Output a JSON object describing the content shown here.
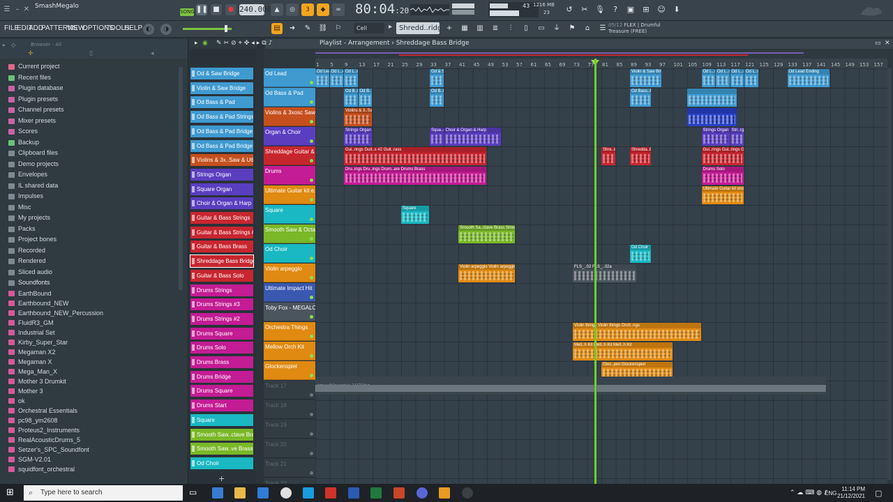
{
  "app": {
    "project_name": "SmashMegalo",
    "song_mode": "SONG",
    "tempo": "240.000",
    "time": {
      "main": "80:04",
      "sub": "20"
    },
    "cpu_value": "43",
    "memory": "1216 MB",
    "voices": "23"
  },
  "menu": {
    "items": [
      "FILE",
      "EDIT",
      "ADD",
      "PATTERNS",
      "VIEW",
      "OPTIONS",
      "TOOLS",
      "HELP"
    ],
    "snap": "Cell",
    "pattern": "Shredd..ridge",
    "plugin_info": {
      "index": "05/12",
      "name": "FLEX | Drumful",
      "preset": "Treasure (FREE)"
    }
  },
  "browser": {
    "header": "Browser - All",
    "folders": [
      {
        "label": "Current project",
        "color": "#e06a8a"
      },
      {
        "label": "Recent files",
        "color": "#6ac27a"
      },
      {
        "label": "Plugin database",
        "color": "#c864a6"
      },
      {
        "label": "Plugin presets",
        "color": "#c864a6"
      },
      {
        "label": "Channel presets",
        "color": "#c864a6"
      },
      {
        "label": "Mixer presets",
        "color": "#c864a6"
      },
      {
        "label": "Scores",
        "color": "#c864a6"
      },
      {
        "label": "Backup",
        "color": "#6ac27a"
      },
      {
        "label": "Clipboard files",
        "color": "#7d8a93"
      },
      {
        "label": "Demo projects",
        "color": "#7d8a93"
      },
      {
        "label": "Envelopes",
        "color": "#7d8a93"
      },
      {
        "label": "IL shared data",
        "color": "#7d8a93"
      },
      {
        "label": "Impulses",
        "color": "#7d8a93"
      },
      {
        "label": "Misc",
        "color": "#7d8a93"
      },
      {
        "label": "My projects",
        "color": "#7d8a93"
      },
      {
        "label": "Packs",
        "color": "#7d8a93"
      },
      {
        "label": "Project bones",
        "color": "#7d8a93"
      },
      {
        "label": "Recorded",
        "color": "#7d8a93"
      },
      {
        "label": "Rendered",
        "color": "#7d8a93"
      },
      {
        "label": "Sliced audio",
        "color": "#7d8a93"
      },
      {
        "label": "Soundfonts",
        "color": "#7d8a93"
      }
    ],
    "soundfonts": [
      "EarthBound",
      "Earthbound_NEW",
      "Earthbound_NEW_Percussion",
      "FluidR3_GM",
      "Industrial Set",
      "Kirby_Super_Star",
      "Megaman X2",
      "Megaman X",
      "Mega_Man_X",
      "Mother 3 Drumkit",
      "Mother 3",
      "ok",
      "Orchestral Essentials",
      "pc98_ym2608",
      "Proteus2_Instruments",
      "RealAcousticDrums_5",
      "Setzer's_SPC_Soundfont",
      "SGM-V2.01",
      "squidfont_orchestral"
    ]
  },
  "playlist": {
    "title": "Playlist - Arrangement",
    "pattern": "Shreddage Bass Bridge",
    "ruler": [
      "1",
      "5",
      "9",
      "13",
      "17",
      "21",
      "25",
      "29",
      "33",
      "37",
      "41",
      "45",
      "49",
      "53",
      "57",
      "61",
      "65",
      "69",
      "73",
      "77",
      "81",
      "85",
      "89",
      "93",
      "97",
      "101",
      "105",
      "109",
      "113",
      "117",
      "121",
      "125",
      "129",
      "133",
      "137",
      "141",
      "145",
      "149",
      "153",
      "157"
    ],
    "tracks": [
      {
        "label": "Od Lead",
        "color": "#3f9ad0"
      },
      {
        "label": "Od Bass & Pad",
        "color": "#3f9ad0"
      },
      {
        "label": "Violins & 3xosc Saw..",
        "color": "#c5501e"
      },
      {
        "label": "Organ & Choir",
        "color": "#5a3ec0"
      },
      {
        "label": "Shreddage Guitar & ..",
        "color": "#c8262f"
      },
      {
        "label": "Drums",
        "color": "#c31c94"
      },
      {
        "label": "Ultimate Guitar kit e..",
        "color": "#e08a12"
      },
      {
        "label": "Square",
        "color": "#1ab8c2"
      },
      {
        "label": "Smooth Saw & Octa..",
        "color": "#7ab828"
      },
      {
        "label": "Od Choir",
        "color": "#1ab8c2"
      },
      {
        "label": "Violin arpeggio",
        "color": "#e08a12"
      },
      {
        "label": "Ultimate Impact Hit",
        "color": "#3a58b0"
      },
      {
        "label": "Toby Fox - MEGALO..",
        "color": "#4a555e"
      },
      {
        "label": "Orchestra Things",
        "color": "#e08a12"
      },
      {
        "label": "Mellow Orch Kit",
        "color": "#e08a12"
      },
      {
        "label": "Glockenspiel",
        "color": "#e08a12"
      },
      {
        "label": "Track 17",
        "color": ""
      },
      {
        "label": "Track 18",
        "color": ""
      },
      {
        "label": "Track 19",
        "color": ""
      },
      {
        "label": "Track 20",
        "color": ""
      },
      {
        "label": "Track 21",
        "color": ""
      },
      {
        "label": "Track 22",
        "color": ""
      }
    ],
    "audio_clip": "smashlovania 192khz",
    "clips": [
      {
        "t": 0,
        "bar": 1,
        "len": 4,
        "label": "Od Lead",
        "color": "#3f9ad0"
      },
      {
        "t": 0,
        "bar": 5,
        "len": 4,
        "label": "Od L..orus",
        "color": "#3f9ad0"
      },
      {
        "t": 0,
        "bar": 9,
        "len": 4,
        "label": "Od L..orus",
        "color": "#3f9ad0"
      },
      {
        "t": 0,
        "bar": 33,
        "len": 4,
        "label": "Od & Saw",
        "color": "#3f9ad0"
      },
      {
        "t": 0,
        "bar": 89,
        "len": 9,
        "label": "Violin & Saw Bridge",
        "color": "#3f9ad0"
      },
      {
        "t": 0,
        "bar": 109,
        "len": 4,
        "label": "Od L..s #2",
        "color": "#3f9ad0"
      },
      {
        "t": 0,
        "bar": 113,
        "len": 4,
        "label": "Od L..s #2",
        "color": "#3f9ad0"
      },
      {
        "t": 0,
        "bar": 117,
        "len": 4,
        "label": "Od L..s #2",
        "color": "#3f9ad0"
      },
      {
        "t": 0,
        "bar": 121,
        "len": 4,
        "label": "Od L..s #2",
        "color": "#3f9ad0"
      },
      {
        "t": 0,
        "bar": 133,
        "len": 12,
        "label": "Od Lead Ending",
        "color": "#3f9ad0"
      },
      {
        "t": 1,
        "bar": 9,
        "len": 4,
        "label": "Od B..Pad",
        "color": "#3f9ad0"
      },
      {
        "t": 1,
        "bar": 13,
        "len": 4,
        "label": "Od B..Pad",
        "color": "#3f9ad0"
      },
      {
        "t": 1,
        "bar": 33,
        "len": 4,
        "label": "Od B..Pad",
        "color": "#3f9ad0"
      },
      {
        "t": 1,
        "bar": 89,
        "len": 6,
        "label": "Od Bass..Bridge",
        "color": "#3f9ad0"
      },
      {
        "t": 1,
        "bar": 105,
        "len": 14,
        "label": "",
        "color": "#3f9ad0"
      },
      {
        "t": 2,
        "bar": 9,
        "len": 8,
        "label": "Violins & 3..Saw & U6k2",
        "color": "#c5501e"
      },
      {
        "t": 2,
        "bar": 105,
        "len": 14,
        "label": "",
        "color": "#2740c4"
      },
      {
        "t": 3,
        "bar": 9,
        "len": 8,
        "label": "Strings Organ",
        "color": "#5a3ec0"
      },
      {
        "t": 3,
        "bar": 33,
        "len": 4,
        "label": "Squa..gan",
        "color": "#5a3ec0"
      },
      {
        "t": 3,
        "bar": 37,
        "len": 16,
        "label": "Choir & Organ & Harp",
        "color": "#5a3ec0"
      },
      {
        "t": 3,
        "bar": 109,
        "len": 8,
        "label": "Strings Organ",
        "color": "#5a3ec0"
      },
      {
        "t": 3,
        "bar": 117,
        "len": 4,
        "label": "Stri..rgan",
        "color": "#5a3ec0"
      },
      {
        "t": 4,
        "bar": 9,
        "len": 40,
        "label": "Gui..rings  Guit..s #2  Guit..rass",
        "color": "#c8262f"
      },
      {
        "t": 4,
        "bar": 81,
        "len": 4,
        "label": "Shre..idge",
        "color": "#c8262f"
      },
      {
        "t": 4,
        "bar": 89,
        "len": 6,
        "label": "Shredda..Bridge",
        "color": "#c8262f"
      },
      {
        "t": 4,
        "bar": 109,
        "len": 12,
        "label": "Gui..rings  Gui..rings  Gui..rings",
        "color": "#c8262f"
      },
      {
        "t": 5,
        "bar": 9,
        "len": 40,
        "label": "Dru..ings  Dru..ings  Drum..are  Drums Brass",
        "color": "#c31c94"
      },
      {
        "t": 5,
        "bar": 109,
        "len": 12,
        "label": "Drums Solo",
        "color": "#c31c94"
      },
      {
        "t": 6,
        "bar": 109,
        "len": 12,
        "label": "Ultimate Guitar kit ending",
        "color": "#e08a12"
      },
      {
        "t": 7,
        "bar": 25,
        "len": 8,
        "label": "Square",
        "color": "#1ab8c2"
      },
      {
        "t": 8,
        "bar": 41,
        "len": 16,
        "label": "Smooth Sa..ctave Brass  Smooth Sa..ve Brass #2",
        "color": "#7ab828"
      },
      {
        "t": 9,
        "bar": 89,
        "len": 6,
        "label": "Od Choir",
        "color": "#1ab8c2"
      },
      {
        "t": 10,
        "bar": 41,
        "len": 16,
        "label": "Violin arpeggio  Violin arpeggio",
        "color": "#e08a12"
      },
      {
        "t": 10,
        "bar": 73,
        "len": 18,
        "label": "FLS_..02  FLS_..02a",
        "color": "#4a555e"
      },
      {
        "t": 13,
        "bar": 73,
        "len": 36,
        "label": "Violin things  Violin things  Orch..ngs",
        "color": "#e08a12"
      },
      {
        "t": 14,
        "bar": 73,
        "len": 28,
        "label": "Mell..h Kit  Mell..h Kit  Mell..h Kit",
        "color": "#e08a12"
      },
      {
        "t": 15,
        "bar": 81,
        "len": 20,
        "label": "Gloc..piel  Glockenspiel",
        "color": "#e08a12"
      }
    ]
  },
  "channels": [
    {
      "label": "Od & Saw Bridge",
      "color": "#3f9ad0"
    },
    {
      "label": "Violin & Saw Bridge",
      "color": "#3f9ad0"
    },
    {
      "label": "Od Bass & Pad",
      "color": "#3f9ad0"
    },
    {
      "label": "Od Bass & Pad Strings",
      "color": "#3f9ad0"
    },
    {
      "label": "Od Bass & Pad Bridge",
      "color": "#3f9ad0"
    },
    {
      "label": "Od Bass & Pad Bridge #2",
      "color": "#3f9ad0"
    },
    {
      "label": "Violins & 3x..Saw & U6k2",
      "color": "#c5501e"
    },
    {
      "label": "Strings Organ",
      "color": "#5a3ec0"
    },
    {
      "label": "Square Organ",
      "color": "#5a3ec0"
    },
    {
      "label": "Choir & Organ & Harp",
      "color": "#5a3ec0"
    },
    {
      "label": "Guitar & Bass Strings",
      "color": "#c8262f"
    },
    {
      "label": "Guitar & Bass Strings #2",
      "color": "#c8262f"
    },
    {
      "label": "Guitar & Bass Brass",
      "color": "#c8262f"
    },
    {
      "label": "Shreddage Bass Bridge",
      "color": "#c8262f"
    },
    {
      "label": "Guitar & Bass Solo",
      "color": "#c8262f"
    },
    {
      "label": "Drums Strings",
      "color": "#c31c94"
    },
    {
      "label": "Drums Strings #3",
      "color": "#c31c94"
    },
    {
      "label": "Drums Strings #2",
      "color": "#c31c94"
    },
    {
      "label": "Drums Square",
      "color": "#c31c94"
    },
    {
      "label": "Drums Solo",
      "color": "#c31c94"
    },
    {
      "label": "Drums Brass",
      "color": "#c31c94"
    },
    {
      "label": "Drums Bridge",
      "color": "#c31c94"
    },
    {
      "label": "Drums Square",
      "color": "#c31c94"
    },
    {
      "label": "Drums Start",
      "color": "#c31c94"
    },
    {
      "label": "Square",
      "color": "#1ab8c2"
    },
    {
      "label": "Smooth Saw..ctave Brass",
      "color": "#7ab828"
    },
    {
      "label": "Smooth Saw..ve Brass #2",
      "color": "#7ab828"
    },
    {
      "label": "Od Choir",
      "color": "#1ab8c2"
    }
  ],
  "taskbar": {
    "search_placeholder": "Type here to search",
    "lang": "ENG",
    "time": "11:14 PM",
    "date": "21/12/2021"
  }
}
